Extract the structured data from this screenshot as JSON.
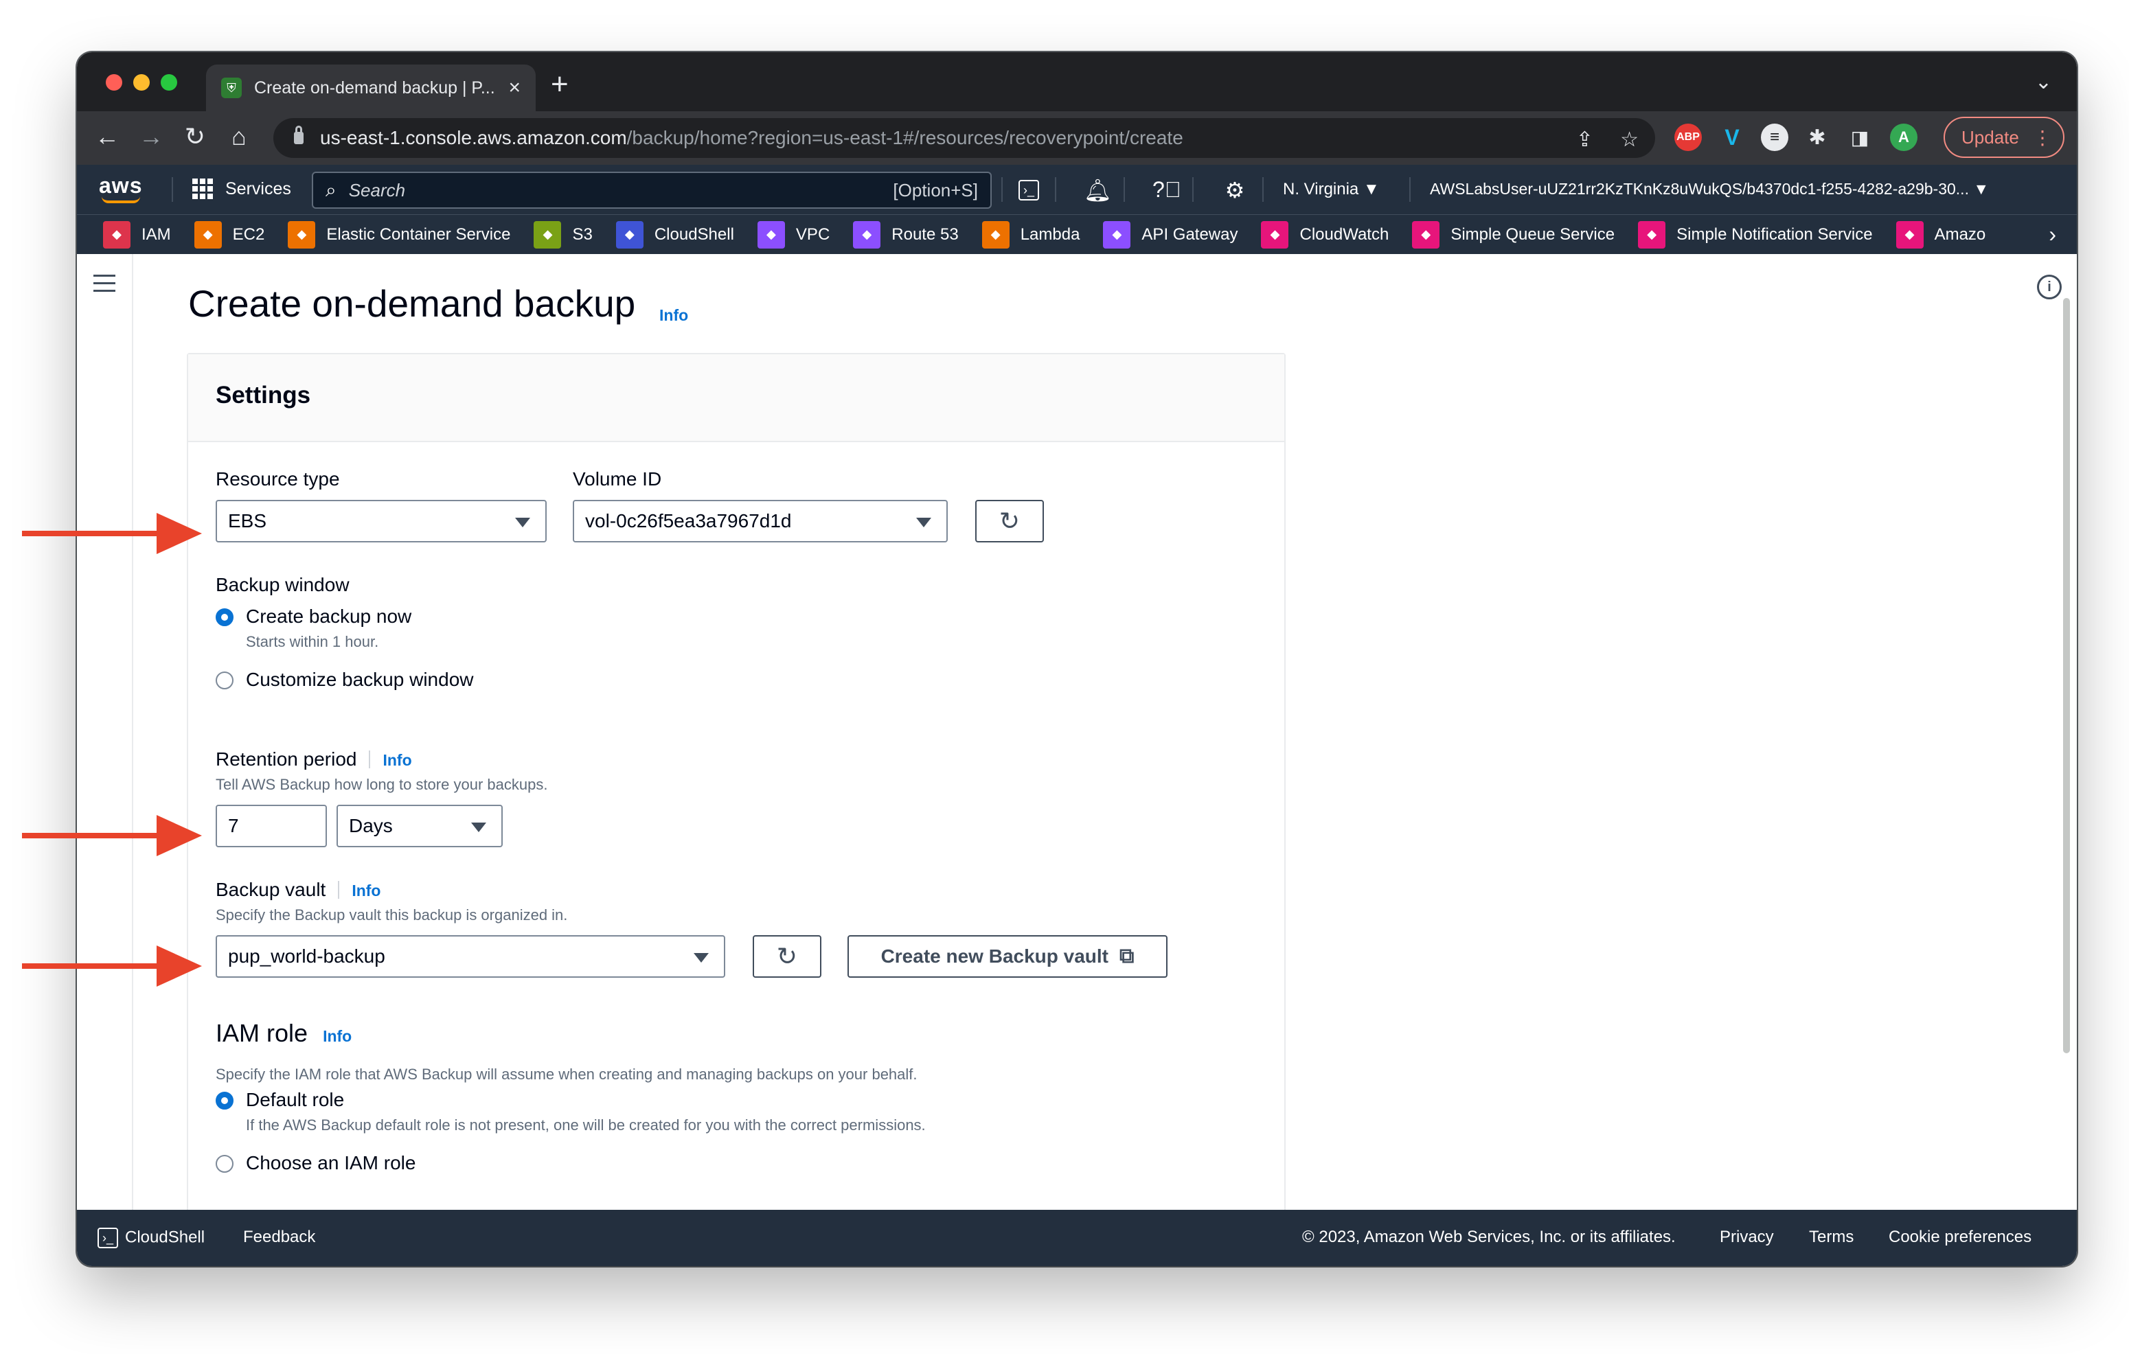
{
  "browser": {
    "tab_title": "Create on-demand backup | P...",
    "url_host": "us-east-1.console.aws.amazon.com",
    "url_path": "/backup/home?region=us-east-1#/resources/recoverypoint/create",
    "update_label": "Update",
    "profile_initial": "A",
    "abp_label": "ABP"
  },
  "aws_nav": {
    "logo": "aws",
    "services_label": "Services",
    "search_placeholder": "Search",
    "search_shortcut": "[Option+S]",
    "region": "N. Virginia ▼",
    "account": "AWSLabsUser-uUZ21rr2KzTKnKz8uWukQS/b4370dc1-f255-4282-a29b-30... ▼"
  },
  "favorites": [
    {
      "label": "IAM",
      "color": "#dd344c"
    },
    {
      "label": "EC2",
      "color": "#ed7100"
    },
    {
      "label": "Elastic Container Service",
      "color": "#ed7100"
    },
    {
      "label": "S3",
      "color": "#7aa116"
    },
    {
      "label": "CloudShell",
      "color": "#3f54d6"
    },
    {
      "label": "VPC",
      "color": "#8c4fff"
    },
    {
      "label": "Route 53",
      "color": "#8c4fff"
    },
    {
      "label": "Lambda",
      "color": "#ed7100"
    },
    {
      "label": "API Gateway",
      "color": "#8c4fff"
    },
    {
      "label": "CloudWatch",
      "color": "#e7157b"
    },
    {
      "label": "Simple Queue Service",
      "color": "#e7157b"
    },
    {
      "label": "Simple Notification Service",
      "color": "#e7157b"
    },
    {
      "label": "Amazo",
      "color": "#e7157b"
    }
  ],
  "page": {
    "title": "Create on-demand backup",
    "title_info": "Info"
  },
  "settings": {
    "heading": "Settings",
    "resource_type_label": "Resource type",
    "resource_type_value": "EBS",
    "volume_id_label": "Volume ID",
    "volume_id_value": "vol-0c26f5ea3a7967d1d",
    "backup_window_label": "Backup window",
    "option_now": "Create backup now",
    "option_now_desc": "Starts within 1 hour.",
    "option_custom": "Customize backup window",
    "retention_label": "Retention period",
    "retention_info": "Info",
    "retention_desc": "Tell AWS Backup how long to store your backups.",
    "retention_value": "7",
    "retention_unit": "Days",
    "vault_label": "Backup vault",
    "vault_info": "Info",
    "vault_desc": "Specify the Backup vault this backup is organized in.",
    "vault_value": "pup_world-backup",
    "create_vault_label": "Create new Backup vault",
    "iam_heading": "IAM role",
    "iam_info": "Info",
    "iam_desc": "Specify the IAM role that AWS Backup will assume when creating and managing backups on your behalf.",
    "iam_default": "Default role",
    "iam_default_desc": "If the AWS Backup default role is not present, one will be created for you with the correct permissions.",
    "iam_choose": "Choose an IAM role"
  },
  "footer": {
    "cloudshell": "CloudShell",
    "feedback": "Feedback",
    "copyright": "© 2023, Amazon Web Services, Inc. or its affiliates.",
    "privacy": "Privacy",
    "terms": "Terms",
    "cookies": "Cookie preferences"
  },
  "colors": {
    "accent": "#0972d3",
    "aws_nav": "#232f3e",
    "annotation_arrow": "#e8432b"
  }
}
